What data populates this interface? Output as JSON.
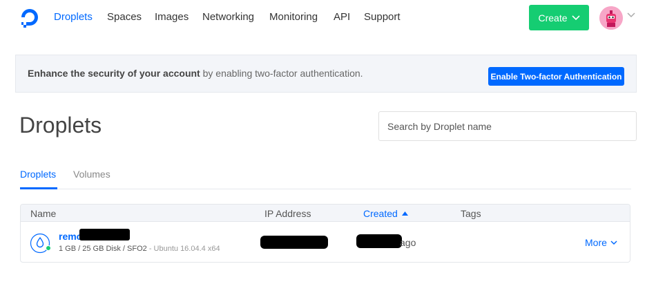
{
  "nav": {
    "items": [
      {
        "label": "Droplets",
        "active": true
      },
      {
        "label": "Spaces"
      },
      {
        "label": "Images"
      },
      {
        "label": "Networking"
      },
      {
        "label": "Monitoring"
      },
      {
        "label": "API"
      },
      {
        "label": "Support"
      }
    ],
    "create_label": "Create",
    "brand_color": "#0069ff",
    "create_color": "#15cd72"
  },
  "banner": {
    "bold_text": "Enhance the security of your account",
    "text": " by enabling two-factor authentication.",
    "button_label": "Enable Two-factor Authentication"
  },
  "page": {
    "title": "Droplets"
  },
  "search": {
    "placeholder": "Search by Droplet name"
  },
  "tabs": [
    {
      "label": "Droplets",
      "active": true
    },
    {
      "label": "Volumes"
    }
  ],
  "table": {
    "columns": [
      "Name",
      "IP Address",
      "Created",
      "Tags"
    ],
    "sorted_column": "Created",
    "rows": [
      {
        "name_visible": "remo",
        "meta": "1 GB / 25 GB Disk / SFO2",
        "os": " - Ubuntu 16.04.4 x64",
        "created_suffix": "ago",
        "status": "active",
        "status_color": "#15cd72",
        "action_label": "More"
      }
    ]
  }
}
